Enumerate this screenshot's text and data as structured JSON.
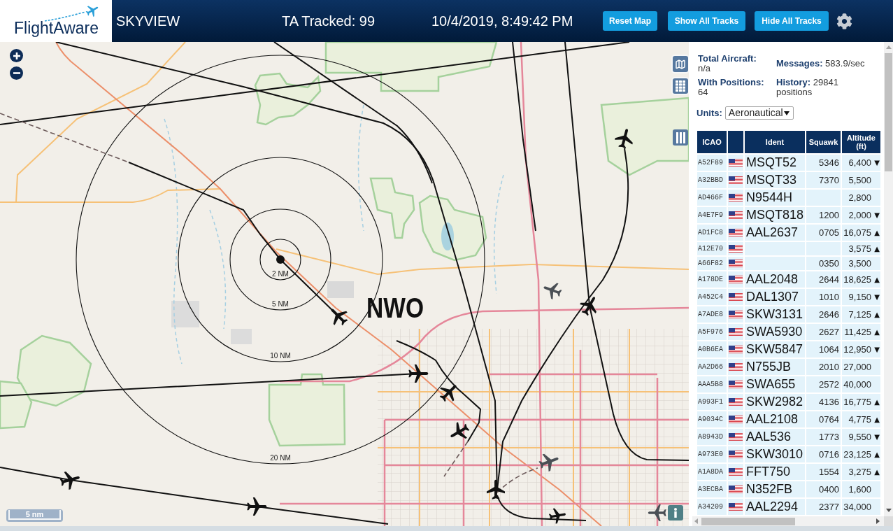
{
  "header": {
    "logo": "FlightAware",
    "title": "SKYVIEW",
    "tracked": "TA Tracked: 99",
    "datetime": "10/4/2019, 8:49:42 PM",
    "buttons": [
      "Reset Map",
      "Show All Tracks",
      "Hide All Tracks"
    ]
  },
  "map": {
    "range_rings": [
      {
        "label": "2 NM"
      },
      {
        "label": "5 NM"
      },
      {
        "label": "10 NM"
      },
      {
        "label": "20 NM"
      }
    ],
    "airport_label": "NWO",
    "scale_label": "5 nm"
  },
  "stats": [
    {
      "label": "Total Aircraft:",
      "value": "n/a"
    },
    {
      "label": "Messages:",
      "value": "583.9/sec"
    },
    {
      "label": "With Positions:",
      "value": "64"
    },
    {
      "label": "History:",
      "value": "29841",
      "unit": "positions"
    }
  ],
  "units": {
    "label": "Units:",
    "value": "Aeronautical"
  },
  "table": {
    "columns": [
      {
        "label": "ICAO"
      },
      {
        "label": "Ident"
      },
      {
        "label": "Squawk"
      },
      {
        "label": "Altitude (ft)"
      }
    ],
    "rows": [
      {
        "icao": "A52F89",
        "ident": "MSQT52",
        "squawk": "5346",
        "altitude": "6,400",
        "trend": "▼"
      },
      {
        "icao": "A32BBD",
        "ident": "MSQT33",
        "squawk": "7370",
        "altitude": "5,500"
      },
      {
        "icao": "AD466F",
        "ident": "N9544H",
        "altitude": "2,800"
      },
      {
        "icao": "A4E7F9",
        "ident": "MSQT818",
        "squawk": "1200",
        "altitude": "2,000",
        "trend": "▼"
      },
      {
        "icao": "AD1FC8",
        "ident": "AAL2637",
        "squawk": "0705",
        "altitude": "16,075",
        "trend": "▲"
      },
      {
        "icao": "A12E70",
        "altitude": "3,575",
        "trend": "▲"
      },
      {
        "icao": "A66F82",
        "squawk": "0350",
        "altitude": "3,500"
      },
      {
        "icao": "A178DE",
        "ident": "AAL2048",
        "squawk": "2644",
        "altitude": "18,625",
        "trend": "▲"
      },
      {
        "icao": "A452C4",
        "ident": "DAL1307",
        "squawk": "1010",
        "altitude": "9,150",
        "trend": "▼"
      },
      {
        "icao": "A7ADE8",
        "ident": "SKW3131",
        "squawk": "2646",
        "altitude": "7,125",
        "trend": "▲"
      },
      {
        "icao": "A5F976",
        "ident": "SWA5930",
        "squawk": "2627",
        "altitude": "11,425",
        "trend": "▲"
      },
      {
        "icao": "A0B6EA",
        "ident": "SKW5847",
        "squawk": "1064",
        "altitude": "12,950",
        "trend": "▼"
      },
      {
        "icao": "AA2D66",
        "ident": "N755JB",
        "squawk": "2010",
        "altitude": "27,000"
      },
      {
        "icao": "AAA5B8",
        "ident": "SWA655",
        "squawk": "2572",
        "altitude": "40,000"
      },
      {
        "icao": "A993F1",
        "ident": "SKW2982",
        "squawk": "4136",
        "altitude": "16,775",
        "trend": "▲"
      },
      {
        "icao": "A9034C",
        "ident": "AAL2108",
        "squawk": "0764",
        "altitude": "4,775",
        "trend": "▲"
      },
      {
        "icao": "A8943D",
        "ident": "AAL536",
        "squawk": "1773",
        "altitude": "9,550",
        "trend": "▼"
      },
      {
        "icao": "A973E0",
        "ident": "SKW3010",
        "squawk": "0716",
        "altitude": "23,125",
        "trend": "▲"
      },
      {
        "icao": "A1A8DA",
        "ident": "FFT750",
        "squawk": "1554",
        "altitude": "3,275",
        "trend": "▲"
      },
      {
        "icao": "A3ECBA",
        "ident": "N352FB",
        "squawk": "0400",
        "altitude": "1,600"
      },
      {
        "icao": "A34209",
        "ident": "AAL2294",
        "squawk": "2377",
        "altitude": "34,000"
      }
    ]
  }
}
